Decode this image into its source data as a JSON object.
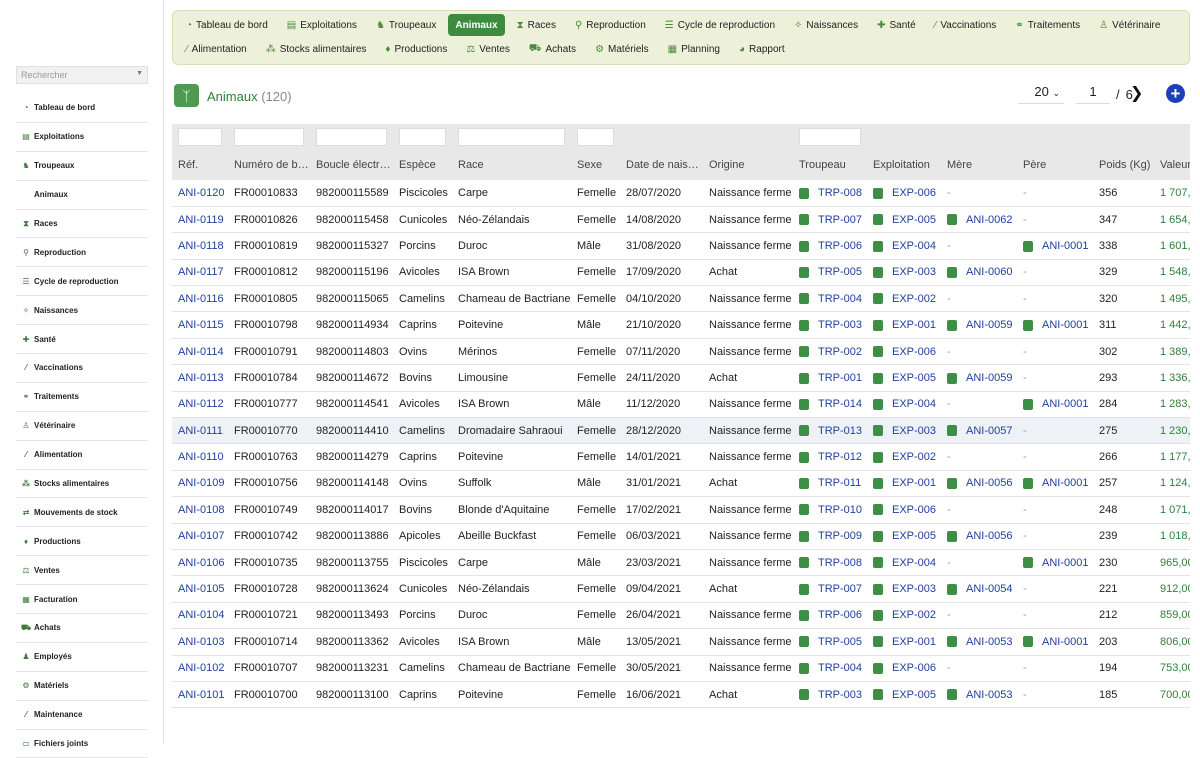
{
  "sidebar": {
    "search_placeholder": "Rechercher",
    "items": [
      {
        "label": "Tableau de bord",
        "icon": "dashboard-icon",
        "glyph": "◔"
      },
      {
        "label": "Exploitations",
        "icon": "barn-icon",
        "glyph": "▤"
      },
      {
        "label": "Troupeaux",
        "icon": "herd-icon",
        "glyph": "♞"
      },
      {
        "label": "Animaux",
        "icon": "",
        "glyph": ""
      },
      {
        "label": "Races",
        "icon": "dna-icon",
        "glyph": "⧗"
      },
      {
        "label": "Reproduction",
        "icon": "reproduction-icon",
        "glyph": "⚲"
      },
      {
        "label": "Cycle de reproduction",
        "icon": "list-icon",
        "glyph": "☰"
      },
      {
        "label": "Naissances",
        "icon": "birth-icon",
        "glyph": "✧"
      },
      {
        "label": "Santé",
        "icon": "health-icon",
        "glyph": "✚"
      },
      {
        "label": "Vaccinations",
        "icon": "syringe-icon",
        "glyph": "⁄"
      },
      {
        "label": "Traitements",
        "icon": "pills-icon",
        "glyph": "⚭"
      },
      {
        "label": "Vétérinaire",
        "icon": "vet-icon",
        "glyph": "♙"
      },
      {
        "label": "Alimentation",
        "icon": "feed-icon",
        "glyph": "⁄"
      },
      {
        "label": "Stocks alimentaires",
        "icon": "stock-icon",
        "glyph": "⁂"
      },
      {
        "label": "Mouvements de stock",
        "icon": "exchange-icon",
        "glyph": "⇄"
      },
      {
        "label": "Productions",
        "icon": "drop-icon",
        "glyph": "♦"
      },
      {
        "label": "Ventes",
        "icon": "sales-icon",
        "glyph": "⚖"
      },
      {
        "label": "Facturation",
        "icon": "invoice-icon",
        "glyph": "▦"
      },
      {
        "label": "Achats",
        "icon": "cart-icon",
        "glyph": "⛟"
      },
      {
        "label": "Employés",
        "icon": "employees-icon",
        "glyph": "♟"
      },
      {
        "label": "Matériels",
        "icon": "equipment-icon",
        "glyph": "⚙"
      },
      {
        "label": "Maintenance",
        "icon": "wrench-icon",
        "glyph": "⁄"
      },
      {
        "label": "Fichiers joints",
        "icon": "attachment-icon",
        "glyph": "▭"
      }
    ]
  },
  "topnav": {
    "row1": [
      {
        "label": "Tableau de bord",
        "icon": "dashboard-icon",
        "glyph": "◔"
      },
      {
        "label": "Exploitations",
        "icon": "barn-icon",
        "glyph": "▤"
      },
      {
        "label": "Troupeaux",
        "icon": "herd-icon",
        "glyph": "♞"
      },
      {
        "label": "Animaux",
        "icon": "",
        "glyph": "",
        "active": true
      },
      {
        "label": "Races",
        "icon": "dna-icon",
        "glyph": "⧗"
      },
      {
        "label": "Reproduction",
        "icon": "reproduction-icon",
        "glyph": "⚲"
      },
      {
        "label": "Cycle de reproduction",
        "icon": "list-icon",
        "glyph": "☰"
      },
      {
        "label": "Naissances",
        "icon": "birth-icon",
        "glyph": "✧"
      },
      {
        "label": "Santé",
        "icon": "health-icon",
        "glyph": "✚"
      },
      {
        "label": "Vaccinations",
        "icon": "syringe-icon",
        "glyph": "⁄"
      },
      {
        "label": "Traitements",
        "icon": "pills-icon",
        "glyph": "⚭"
      },
      {
        "label": "Vétérinaire",
        "icon": "vet-icon",
        "glyph": "♙"
      }
    ],
    "row2": [
      {
        "label": "Alimentation",
        "icon": "feed-icon",
        "glyph": "⁄"
      },
      {
        "label": "Stocks alimentaires",
        "icon": "stock-icon",
        "glyph": "⁂"
      },
      {
        "label": "Productions",
        "icon": "drop-icon",
        "glyph": "♦"
      },
      {
        "label": "Ventes",
        "icon": "sales-icon",
        "glyph": "⚖"
      },
      {
        "label": "Achats",
        "icon": "cart-icon",
        "glyph": "⛟"
      },
      {
        "label": "Matériels",
        "icon": "equipment-icon",
        "glyph": "⚙"
      },
      {
        "label": "Planning",
        "icon": "calendar-icon",
        "glyph": "▦"
      },
      {
        "label": "Rapport",
        "icon": "report-icon",
        "glyph": "◕"
      }
    ]
  },
  "page": {
    "title": "Animaux",
    "count": "(120)",
    "per_page": "20",
    "current_page": "1",
    "page_separator": "/",
    "total_pages": "6",
    "next_glyph": "❯",
    "add_glyph": "+"
  },
  "table": {
    "columns": [
      "Réf.",
      "Numéro de b…",
      "Boucle électr…",
      "Espèce",
      "Race",
      "Sexe",
      "Date de nais…",
      "Origine",
      "Troupeau",
      "Exploitation",
      "Mère",
      "Père",
      "Poids (Kg)",
      "Valeur"
    ],
    "rows": [
      [
        "ANI-0120",
        "FR00010833",
        "982000115589",
        "Piscicoles",
        "Carpe",
        "Femelle",
        "28/07/2020",
        "Naissance ferme",
        "TRP-008",
        "EXP-006",
        "-",
        "-",
        "356",
        "1 707,"
      ],
      [
        "ANI-0119",
        "FR00010826",
        "982000115458",
        "Cunicoles",
        "Néo-Zélandais",
        "Femelle",
        "14/08/2020",
        "Naissance ferme",
        "TRP-007",
        "EXP-005",
        "ANI-0062",
        "-",
        "347",
        "1 654,"
      ],
      [
        "ANI-0118",
        "FR00010819",
        "982000115327",
        "Porcins",
        "Duroc",
        "Mâle",
        "31/08/2020",
        "Naissance ferme",
        "TRP-006",
        "EXP-004",
        "-",
        "ANI-0001",
        "338",
        "1 601,"
      ],
      [
        "ANI-0117",
        "FR00010812",
        "982000115196",
        "Avicoles",
        "ISA Brown",
        "Femelle",
        "17/09/2020",
        "Achat",
        "TRP-005",
        "EXP-003",
        "ANI-0060",
        "-",
        "329",
        "1 548,"
      ],
      [
        "ANI-0116",
        "FR00010805",
        "982000115065",
        "Camelins",
        "Chameau de Bactriane",
        "Femelle",
        "04/10/2020",
        "Naissance ferme",
        "TRP-004",
        "EXP-002",
        "-",
        "-",
        "320",
        "1 495,"
      ],
      [
        "ANI-0115",
        "FR00010798",
        "982000114934",
        "Caprins",
        "Poitevine",
        "Mâle",
        "21/10/2020",
        "Naissance ferme",
        "TRP-003",
        "EXP-001",
        "ANI-0059",
        "ANI-0001",
        "311",
        "1 442,"
      ],
      [
        "ANI-0114",
        "FR00010791",
        "982000114803",
        "Ovins",
        "Mérinos",
        "Femelle",
        "07/11/2020",
        "Naissance ferme",
        "TRP-002",
        "EXP-006",
        "-",
        "-",
        "302",
        "1 389,"
      ],
      [
        "ANI-0113",
        "FR00010784",
        "982000114672",
        "Bovins",
        "Limousine",
        "Femelle",
        "24/11/2020",
        "Achat",
        "TRP-001",
        "EXP-005",
        "ANI-0059",
        "-",
        "293",
        "1 336,"
      ],
      [
        "ANI-0112",
        "FR00010777",
        "982000114541",
        "Avicoles",
        "ISA Brown",
        "Mâle",
        "11/12/2020",
        "Naissance ferme",
        "TRP-014",
        "EXP-004",
        "-",
        "ANI-0001",
        "284",
        "1 283,"
      ],
      [
        "ANI-0111",
        "FR00010770",
        "982000114410",
        "Camelins",
        "Dromadaire Sahraoui",
        "Femelle",
        "28/12/2020",
        "Naissance ferme",
        "TRP-013",
        "EXP-003",
        "ANI-0057",
        "-",
        "275",
        "1 230,"
      ],
      [
        "ANI-0110",
        "FR00010763",
        "982000114279",
        "Caprins",
        "Poitevine",
        "Femelle",
        "14/01/2021",
        "Naissance ferme",
        "TRP-012",
        "EXP-002",
        "-",
        "-",
        "266",
        "1 177,"
      ],
      [
        "ANI-0109",
        "FR00010756",
        "982000114148",
        "Ovins",
        "Suffolk",
        "Mâle",
        "31/01/2021",
        "Achat",
        "TRP-011",
        "EXP-001",
        "ANI-0056",
        "ANI-0001",
        "257",
        "1 124,"
      ],
      [
        "ANI-0108",
        "FR00010749",
        "982000114017",
        "Bovins",
        "Blonde d'Aquitaine",
        "Femelle",
        "17/02/2021",
        "Naissance ferme",
        "TRP-010",
        "EXP-006",
        "-",
        "-",
        "248",
        "1 071,"
      ],
      [
        "ANI-0107",
        "FR00010742",
        "982000113886",
        "Apicoles",
        "Abeille Buckfast",
        "Femelle",
        "06/03/2021",
        "Naissance ferme",
        "TRP-009",
        "EXP-005",
        "ANI-0056",
        "-",
        "239",
        "1 018,"
      ],
      [
        "ANI-0106",
        "FR00010735",
        "982000113755",
        "Piscicoles",
        "Carpe",
        "Mâle",
        "23/03/2021",
        "Naissance ferme",
        "TRP-008",
        "EXP-004",
        "-",
        "ANI-0001",
        "230",
        "965,00"
      ],
      [
        "ANI-0105",
        "FR00010728",
        "982000113624",
        "Cunicoles",
        "Néo-Zélandais",
        "Femelle",
        "09/04/2021",
        "Achat",
        "TRP-007",
        "EXP-003",
        "ANI-0054",
        "-",
        "221",
        "912,00"
      ],
      [
        "ANI-0104",
        "FR00010721",
        "982000113493",
        "Porcins",
        "Duroc",
        "Femelle",
        "26/04/2021",
        "Naissance ferme",
        "TRP-006",
        "EXP-002",
        "-",
        "-",
        "212",
        "859,00"
      ],
      [
        "ANI-0103",
        "FR00010714",
        "982000113362",
        "Avicoles",
        "ISA Brown",
        "Mâle",
        "13/05/2021",
        "Naissance ferme",
        "TRP-005",
        "EXP-001",
        "ANI-0053",
        "ANI-0001",
        "203",
        "806,00"
      ],
      [
        "ANI-0102",
        "FR00010707",
        "982000113231",
        "Camelins",
        "Chameau de Bactriane",
        "Femelle",
        "30/05/2021",
        "Naissance ferme",
        "TRP-004",
        "EXP-006",
        "-",
        "-",
        "194",
        "753,00"
      ],
      [
        "ANI-0101",
        "FR00010700",
        "982000113100",
        "Caprins",
        "Poitevine",
        "Femelle",
        "16/06/2021",
        "Achat",
        "TRP-003",
        "EXP-005",
        "ANI-0053",
        "-",
        "185",
        "700,00"
      ]
    ],
    "highlighted_row": 9
  },
  "colors": {
    "accent_green": "#3d8a41",
    "nav_background": "#eef1d9",
    "link_blue": "#1f3f9e",
    "add_button": "#1d3fb8"
  }
}
